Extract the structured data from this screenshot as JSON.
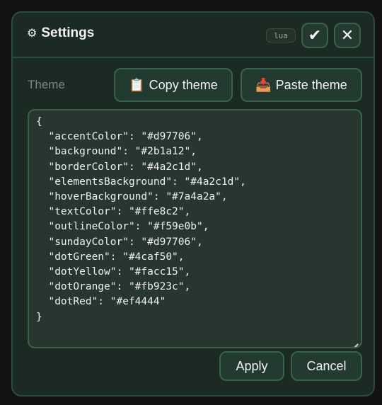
{
  "dialog": {
    "title": "Settings",
    "title_icon": "gear-icon",
    "badge": "lua",
    "confirm_icon": "checkmark-icon",
    "close_icon": "close-icon"
  },
  "theme": {
    "label": "Theme",
    "copy_button": {
      "icon": "📋",
      "label": "Copy theme"
    },
    "paste_button": {
      "icon": "📥",
      "label": "Paste theme"
    },
    "editor_text": "{\n  \"accentColor\": \"#d97706\",\n  \"background\": \"#2b1a12\",\n  \"borderColor\": \"#4a2c1d\",\n  \"elementsBackground\": \"#4a2c1d\",\n  \"hoverBackground\": \"#7a4a2a\",\n  \"textColor\": \"#ffe8c2\",\n  \"outlineColor\": \"#f59e0b\",\n  \"sundayColor\": \"#d97706\",\n  \"dotGreen\": \"#4caf50\",\n  \"dotYellow\": \"#facc15\",\n  \"dotOrange\": \"#fb923c\",\n  \"dotRed\": \"#ef4444\"\n}"
  },
  "footer": {
    "apply_label": "Apply",
    "cancel_label": "Cancel"
  },
  "colors": {
    "dialog_background": "#1c2a24",
    "border": "#2c4c3f",
    "button_background": "#233a30",
    "button_border": "#3a6150",
    "editor_background": "#27372f",
    "text": "#f2f2f2",
    "muted_text": "#7c8580"
  }
}
